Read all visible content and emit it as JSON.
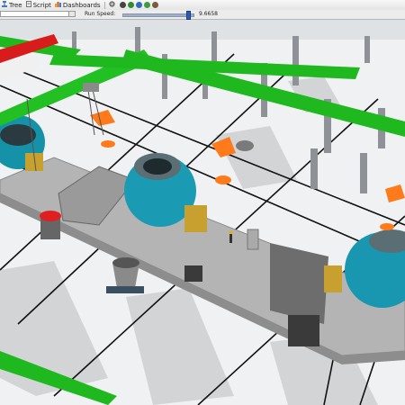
{
  "toolbar": {
    "tree_label": "Tree",
    "script_label": "Script",
    "dashboards_label": "Dashboards"
  },
  "run_speed": {
    "label": "Run Speed:",
    "value": "9.6658",
    "slider_fraction": 0.93
  },
  "colors": {
    "pipe_green": "#1fb91f",
    "vessel_teal": "#19a3b8",
    "ladle_orange": "#ff7a1a",
    "floor": "#eef0f1",
    "platform": "#b3b3b3"
  },
  "icons": [
    "tree-icon",
    "script-icon",
    "dashboards-icon",
    "gear-icon",
    "play-icon",
    "reset-icon",
    "step-icon",
    "stop-icon"
  ]
}
